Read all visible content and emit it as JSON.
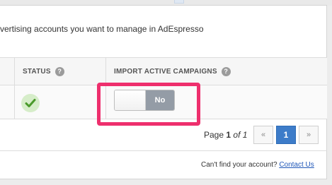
{
  "intro_text": "vertising accounts you want to manage in AdEspresso",
  "table": {
    "columns": [
      {
        "label": "STATUS",
        "help_icon": "question-icon"
      },
      {
        "label": "IMPORT ACTIVE CAMPAIGNS",
        "help_icon": "question-icon"
      }
    ],
    "row": {
      "status_icon": "check-icon",
      "import_toggle": {
        "value": "No",
        "state": "off"
      }
    }
  },
  "help_glyph": "?",
  "pagination": {
    "prefix": "Page",
    "current": "1",
    "of_text": "of 1",
    "prev": "«",
    "page_button": "1",
    "next": "»"
  },
  "footer": {
    "question": "Can't find your account?",
    "link_label": "Contact Us"
  },
  "colors": {
    "highlight": "#ee2f6d",
    "active_page": "#3d7cc9",
    "link": "#1f57b8",
    "check": "#4a9a2b"
  }
}
